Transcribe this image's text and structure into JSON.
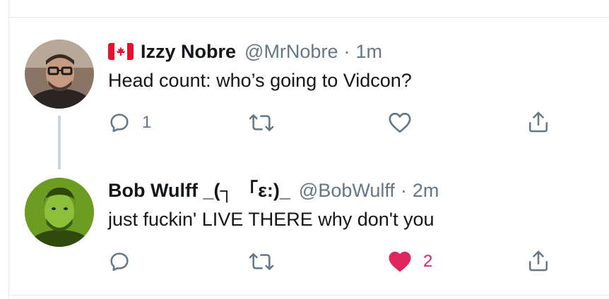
{
  "tweets": [
    {
      "name": "Izzy Nobre",
      "handle": "@MrNobre",
      "separator": "·",
      "time": "1m",
      "text": "Head count: who’s going to Vidcon?",
      "reply_count": "1",
      "retweet_count": "",
      "like_count": "",
      "liked": false,
      "name_flag": "canada-flag-icon"
    },
    {
      "name": "Bob Wulff _(┐ 「ε:)_",
      "handle": "@BobWulff",
      "separator": "·",
      "time": "2m",
      "text": "just fuckin' LIVE THERE why don't you",
      "reply_count": "",
      "retweet_count": "",
      "like_count": "2",
      "liked": true
    }
  ],
  "colors": {
    "text_primary": "#14171a",
    "text_secondary": "#657786",
    "like_active": "#e0245e",
    "divider": "#e6ecf0",
    "thread_line": "#ccd6dd"
  }
}
